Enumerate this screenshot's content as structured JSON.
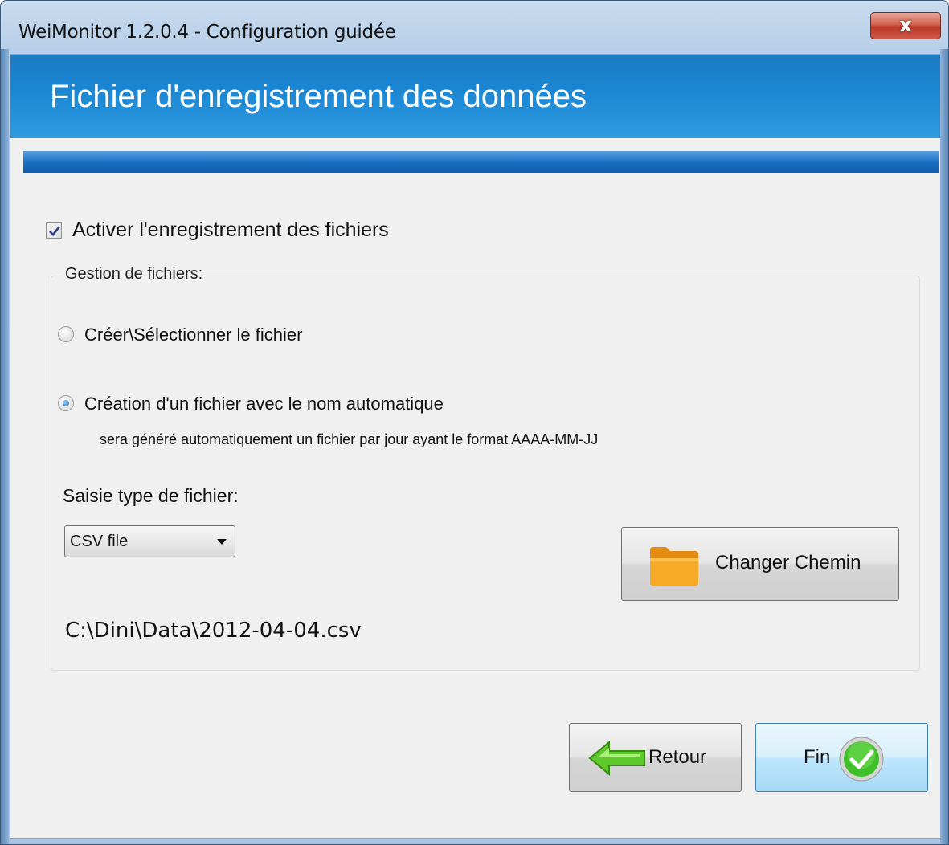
{
  "window": {
    "title": "WeiMonitor 1.2.0.4 - Configuration guidée",
    "close_glyph": "x"
  },
  "header": {
    "title": "Fichier d'enregistrement des données"
  },
  "enable_checkbox": {
    "label": "Activer l'enregistrement des fichiers",
    "checked": true
  },
  "file_group": {
    "legend": "Gestion de fichiers:",
    "options": [
      {
        "label": "Créer\\Sélectionner le fichier",
        "selected": false
      },
      {
        "label": "Création d'un fichier avec le nom automatique",
        "selected": true,
        "hint": "sera généré automatiquement un fichier par jour ayant le format AAAA-MM-JJ"
      }
    ],
    "file_type_label": "Saisie type de fichier:",
    "file_type_value": "CSV file",
    "change_path_label": "Changer Chemin",
    "path": "C:\\Dini\\Data\\2012-04-04.csv"
  },
  "buttons": {
    "back_label": "Retour",
    "finish_label": "Fin"
  },
  "colors": {
    "header_blue": "#1a86d3",
    "folder_orange": "#f0a020",
    "back_arrow_green": "#5cc82a",
    "finish_check_green": "#3fbf2a"
  }
}
